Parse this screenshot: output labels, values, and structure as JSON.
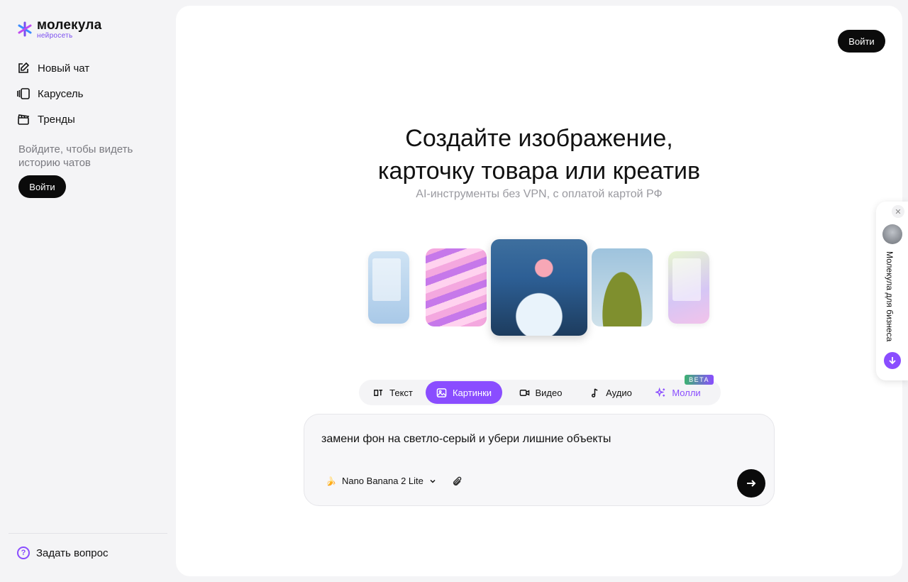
{
  "brand": {
    "name": "молекула",
    "subtitle": "нейросеть",
    "accent": "#8a4dff"
  },
  "sidebar": {
    "items": [
      {
        "label": "Новый чат",
        "icon": "edit-icon"
      },
      {
        "label": "Карусель",
        "icon": "carousel-icon"
      },
      {
        "label": "Тренды",
        "icon": "clapperboard-icon"
      }
    ],
    "login_hint": "Войдите, чтобы видеть историю чатов",
    "login_label": "Войти",
    "ask_label": "Задать вопрос"
  },
  "header": {
    "login_label": "Войти"
  },
  "hero": {
    "title_line1": "Создайте изображение,",
    "title_line2": "карточку товара или креатив",
    "subtitle": "AI-инструменты без VPN, с оплатой картой РФ"
  },
  "tabs": [
    {
      "label": "Текст",
      "icon": "text-icon",
      "active": false
    },
    {
      "label": "Картинки",
      "icon": "image-icon",
      "active": true
    },
    {
      "label": "Видео",
      "icon": "video-icon",
      "active": false
    },
    {
      "label": "Аудио",
      "icon": "music-note-icon",
      "active": false
    },
    {
      "label": "Молли",
      "icon": "sparkles-icon",
      "active": false,
      "badge": "BETA"
    }
  ],
  "prompt": {
    "text": "замени фон на светло-серый и убери лишние объекты",
    "model": "Nano Banana 2 Lite"
  },
  "business_widget": {
    "label": "Молекула для бизнеса"
  }
}
